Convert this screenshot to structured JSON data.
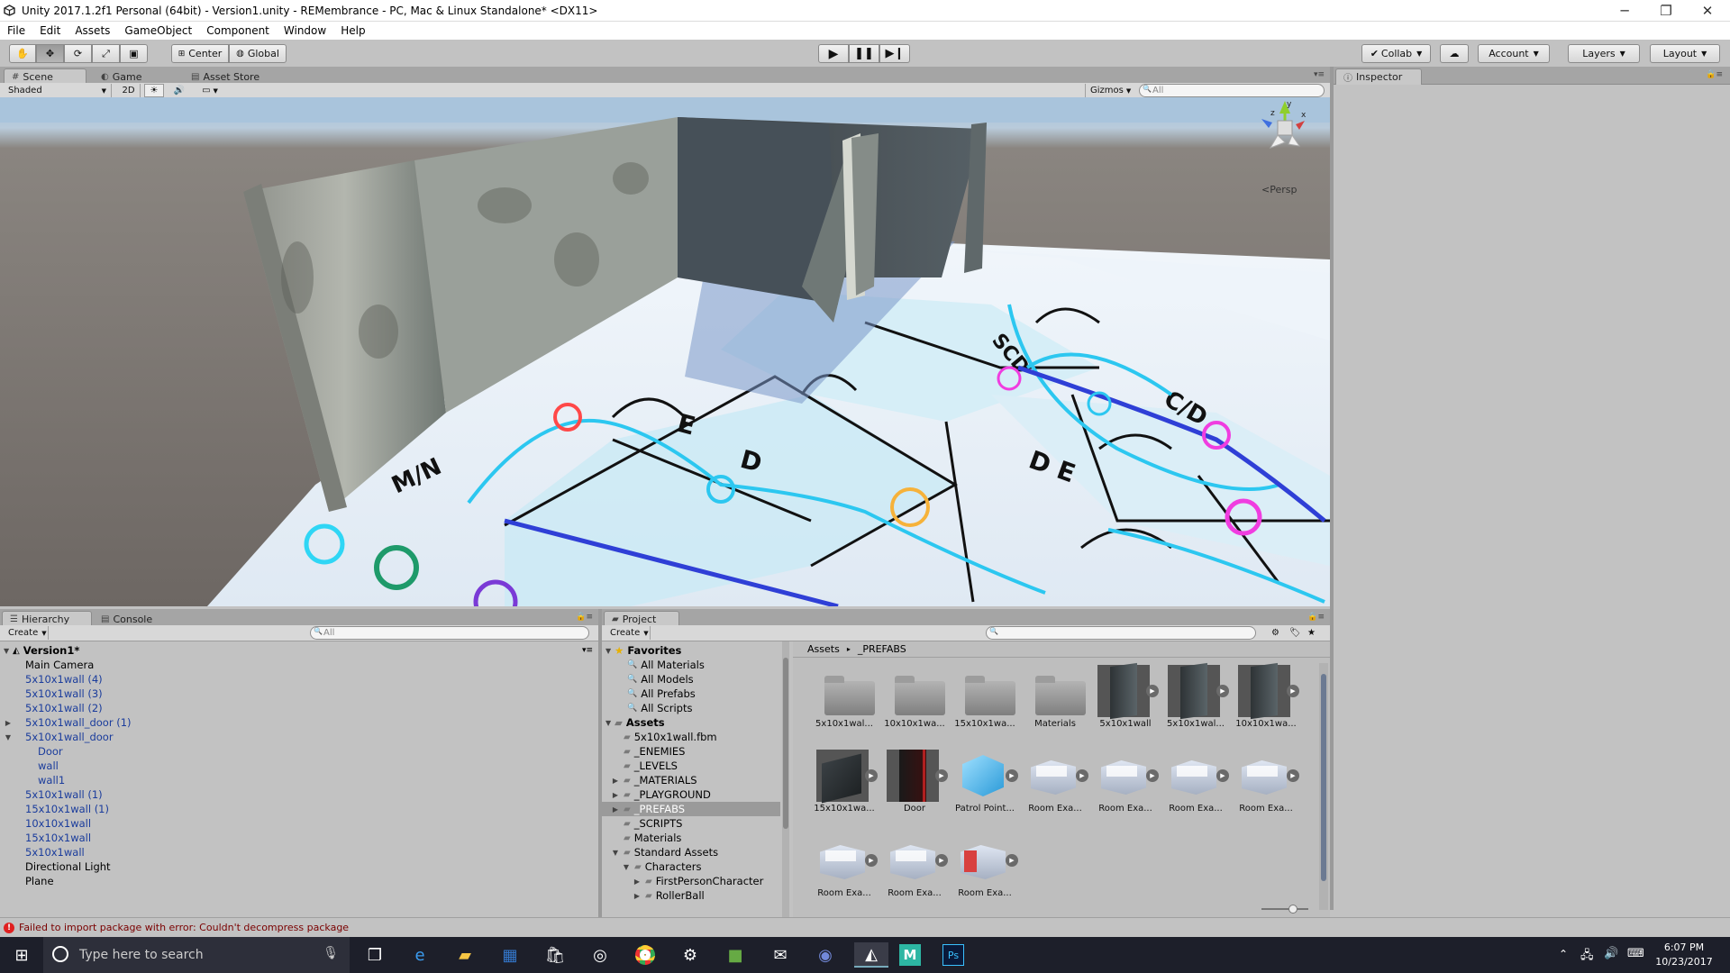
{
  "window": {
    "title": "Unity 2017.1.2f1 Personal (64bit) - Version1.unity - REMembrance - PC, Mac & Linux Standalone* <DX11>",
    "minimize": "─",
    "restore": "❐",
    "close": "✕"
  },
  "menu": [
    "File",
    "Edit",
    "Assets",
    "GameObject",
    "Component",
    "Window",
    "Help"
  ],
  "toolbar": {
    "pivot": "Center",
    "space": "Global",
    "collab": "Collab",
    "account": "Account",
    "layers": "Layers",
    "layout": "Layout"
  },
  "scene_panel": {
    "tabs": [
      "Scene",
      "Game",
      "Asset Store"
    ],
    "shading": "Shaded",
    "mode_2d": "2D",
    "gizmos": "Gizmos",
    "search_placeholder": "All",
    "projection": "Persp",
    "gizmo_axes": [
      "y",
      "z",
      "x"
    ]
  },
  "inspector": {
    "tab": "Inspector"
  },
  "hierarchy": {
    "tabs": [
      "Hierarchy",
      "Console"
    ],
    "create": "Create",
    "search_placeholder": "All",
    "scene_name": "Version1*",
    "items": [
      {
        "label": "Main Camera",
        "prefab": false,
        "indent": 0,
        "expander": ""
      },
      {
        "label": "5x10x1wall (4)",
        "prefab": true,
        "indent": 0,
        "expander": ""
      },
      {
        "label": "5x10x1wall (3)",
        "prefab": true,
        "indent": 0,
        "expander": ""
      },
      {
        "label": "5x10x1wall (2)",
        "prefab": true,
        "indent": 0,
        "expander": ""
      },
      {
        "label": "5x10x1wall_door (1)",
        "prefab": true,
        "indent": 0,
        "expander": "▶"
      },
      {
        "label": "5x10x1wall_door",
        "prefab": true,
        "indent": 0,
        "expander": "▼"
      },
      {
        "label": "Door",
        "prefab": true,
        "indent": 1,
        "expander": ""
      },
      {
        "label": "wall",
        "prefab": true,
        "indent": 1,
        "expander": ""
      },
      {
        "label": "wall1",
        "prefab": true,
        "indent": 1,
        "expander": ""
      },
      {
        "label": "5x10x1wall (1)",
        "prefab": true,
        "indent": 0,
        "expander": ""
      },
      {
        "label": "15x10x1wall (1)",
        "prefab": true,
        "indent": 0,
        "expander": ""
      },
      {
        "label": "10x10x1wall",
        "prefab": true,
        "indent": 0,
        "expander": ""
      },
      {
        "label": "15x10x1wall",
        "prefab": true,
        "indent": 0,
        "expander": ""
      },
      {
        "label": "5x10x1wall",
        "prefab": true,
        "indent": 0,
        "expander": ""
      },
      {
        "label": "Directional Light",
        "prefab": false,
        "indent": 0,
        "expander": ""
      },
      {
        "label": "Plane",
        "prefab": false,
        "indent": 0,
        "expander": ""
      }
    ]
  },
  "project": {
    "tab": "Project",
    "create": "Create",
    "favorites_header": "Favorites",
    "favorites": [
      "All Materials",
      "All Models",
      "All Prefabs",
      "All Scripts"
    ],
    "assets_header": "Assets",
    "tree": [
      {
        "label": "5x10x1wall.fbm",
        "indent": 1,
        "expander": "",
        "selected": false
      },
      {
        "label": "_ENEMIES",
        "indent": 1,
        "expander": "",
        "selected": false
      },
      {
        "label": "_LEVELS",
        "indent": 1,
        "expander": "",
        "selected": false
      },
      {
        "label": "_MATERIALS",
        "indent": 1,
        "expander": "▶",
        "selected": false
      },
      {
        "label": "_PLAYGROUND",
        "indent": 1,
        "expander": "▶",
        "selected": false
      },
      {
        "label": "_PREFABS",
        "indent": 1,
        "expander": "▶",
        "selected": true
      },
      {
        "label": "_SCRIPTS",
        "indent": 1,
        "expander": "",
        "selected": false
      },
      {
        "label": "Materials",
        "indent": 1,
        "expander": "",
        "selected": false
      },
      {
        "label": "Standard Assets",
        "indent": 1,
        "expander": "▼",
        "selected": false
      },
      {
        "label": "Characters",
        "indent": 2,
        "expander": "▼",
        "selected": false
      },
      {
        "label": "FirstPersonCharacter",
        "indent": 3,
        "expander": "▶",
        "selected": false
      },
      {
        "label": "RollerBall",
        "indent": 3,
        "expander": "▶",
        "selected": false
      }
    ],
    "breadcrumb": [
      "Assets",
      "_PREFABS"
    ],
    "breadcrumb_sep": "▸",
    "assets": [
      {
        "label": "5x10x1wal...",
        "kind": "folder"
      },
      {
        "label": "10x10x1wa...",
        "kind": "folder"
      },
      {
        "label": "15x10x1wa...",
        "kind": "folder"
      },
      {
        "label": "Materials",
        "kind": "folder"
      },
      {
        "label": "5x10x1wall",
        "kind": "wall"
      },
      {
        "label": "5x10x1wal...",
        "kind": "wall"
      },
      {
        "label": "10x10x1wa...",
        "kind": "wall"
      },
      {
        "label": "15x10x1wa...",
        "kind": "wallflat"
      },
      {
        "label": "Door",
        "kind": "door"
      },
      {
        "label": "Patrol Point...",
        "kind": "cube"
      },
      {
        "label": "Room Exa...",
        "kind": "room"
      },
      {
        "label": "Room Exa...",
        "kind": "room"
      },
      {
        "label": "Room Exa...",
        "kind": "room"
      },
      {
        "label": "Room Exa...",
        "kind": "room"
      },
      {
        "label": "Room Exa...",
        "kind": "room"
      },
      {
        "label": "Room Exa...",
        "kind": "room"
      },
      {
        "label": "Room Exa...",
        "kind": "roomred"
      }
    ]
  },
  "status": {
    "message": "Failed to import package with error: Couldn't decompress package"
  },
  "taskbar": {
    "search_placeholder": "Type here to search",
    "time": "6:07 PM",
    "date": "10/23/2017"
  }
}
